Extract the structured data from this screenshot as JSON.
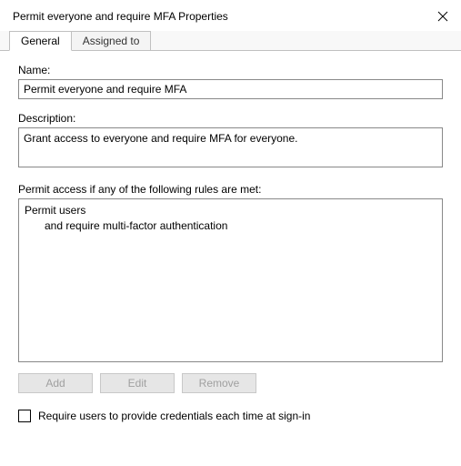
{
  "window": {
    "title": "Permit everyone and require MFA Properties"
  },
  "tabs": {
    "general": "General",
    "assigned_to": "Assigned to"
  },
  "labels": {
    "name": "Name:",
    "description": "Description:",
    "rules_header": "Permit access if any of the following rules are met:"
  },
  "fields": {
    "name_value": "Permit everyone and require MFA",
    "description_value": "Grant access to everyone and require MFA for everyone."
  },
  "rules": {
    "line1": "Permit users",
    "line2": "and require multi-factor authentication"
  },
  "buttons": {
    "add": "Add",
    "edit": "Edit",
    "remove": "Remove"
  },
  "checkbox": {
    "label": "Require users to provide credentials each time at sign-in",
    "checked": false
  }
}
